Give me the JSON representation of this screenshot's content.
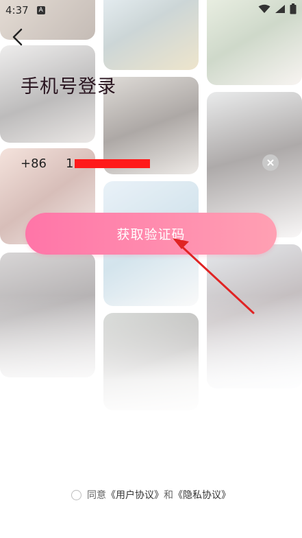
{
  "status_bar": {
    "time": "4:37",
    "app_icon_letter": "A"
  },
  "header": {
    "title": "手机号登录"
  },
  "phone": {
    "country_code": "+86",
    "number_prefix": "1"
  },
  "primary_button": {
    "label": "获取验证码"
  },
  "agreement": {
    "text_prefix": "同意",
    "user_agreement": "《用户协议》",
    "connector": "和",
    "privacy_policy": "《隐私协议》"
  },
  "colors": {
    "accent_start": "#ff75a8",
    "accent_end": "#ffa0b3",
    "annotation_arrow": "#e02424",
    "redaction": "#ff1a1a"
  }
}
